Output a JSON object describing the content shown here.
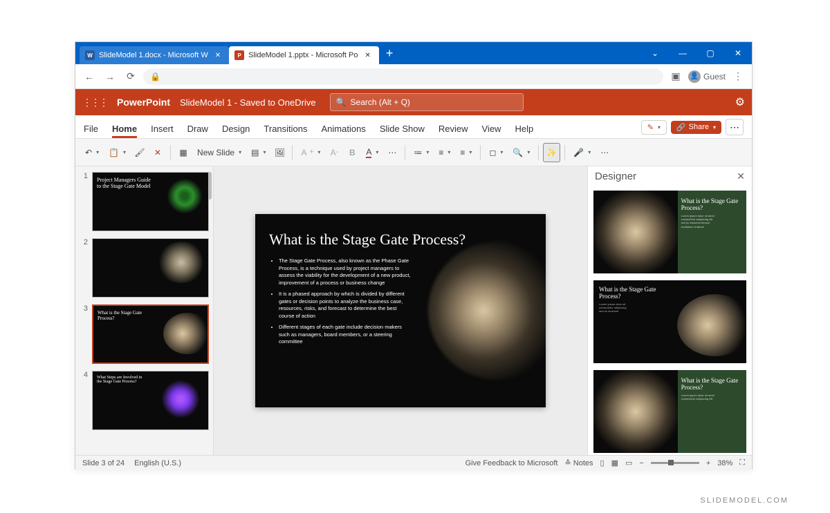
{
  "browser": {
    "tabs": [
      {
        "label": "SlideModel 1.docx - Microsoft W",
        "favicon_text": "W",
        "favicon_bg": "#2b579a",
        "active": false
      },
      {
        "label": "SlideModel 1.pptx - Microsoft Po",
        "favicon_text": "P",
        "favicon_bg": "#c43e1c",
        "active": true
      }
    ],
    "guest_label": "Guest"
  },
  "appheader": {
    "name": "PowerPoint",
    "doc": "SlideModel 1",
    "saved_to": " - Saved to OneDrive",
    "search_placeholder": "Search (Alt + Q)"
  },
  "ribbon": {
    "tabs": [
      "File",
      "Home",
      "Insert",
      "Draw",
      "Design",
      "Transitions",
      "Animations",
      "Slide Show",
      "Review",
      "View",
      "Help"
    ],
    "active_index": 1,
    "share_label": "Share"
  },
  "toolbar": {
    "new_slide_label": "New Slide"
  },
  "thumbs": [
    {
      "num": "1",
      "title": "Project Managers Guide to the Stage Gate Model",
      "kind": "mandala"
    },
    {
      "num": "2",
      "title": "",
      "kind": "photo"
    },
    {
      "num": "3",
      "title": "What is the Stage Gate Process?",
      "kind": "photo",
      "selected": true
    },
    {
      "num": "4",
      "title": "What Steps are Involved in the Stage Gate Process?",
      "kind": "purple"
    }
  ],
  "slide": {
    "title": "What is the Stage Gate Process?",
    "bullets": [
      "The Stage Gate Process, also known as the Phase Gate Process, is a technique used by project managers to assess the viability for the development of a new product, improvement of a process or business change",
      "It is a phased approach by which is divided by different gates or decision points to analyze the business case, resources, risks, and forecast to determine the best course of action",
      "Different stages of each gate include decision makers such as managers, board members, or a steering committee"
    ]
  },
  "designer": {
    "label": "Designer",
    "cards": [
      {
        "title": "What is the Stage Gate Process?",
        "layout": "green"
      },
      {
        "title": "What is the Stage Gate Process?",
        "layout": "dark"
      },
      {
        "title": "What is the Stage Gate Process?",
        "layout": "green"
      }
    ]
  },
  "statusbar": {
    "slide_info": "Slide 3 of 24",
    "language": "English (U.S.)",
    "feedback": "Give Feedback to Microsoft",
    "notes": "Notes",
    "zoom": "38%"
  },
  "attribution": "SLIDEMODEL.COM"
}
